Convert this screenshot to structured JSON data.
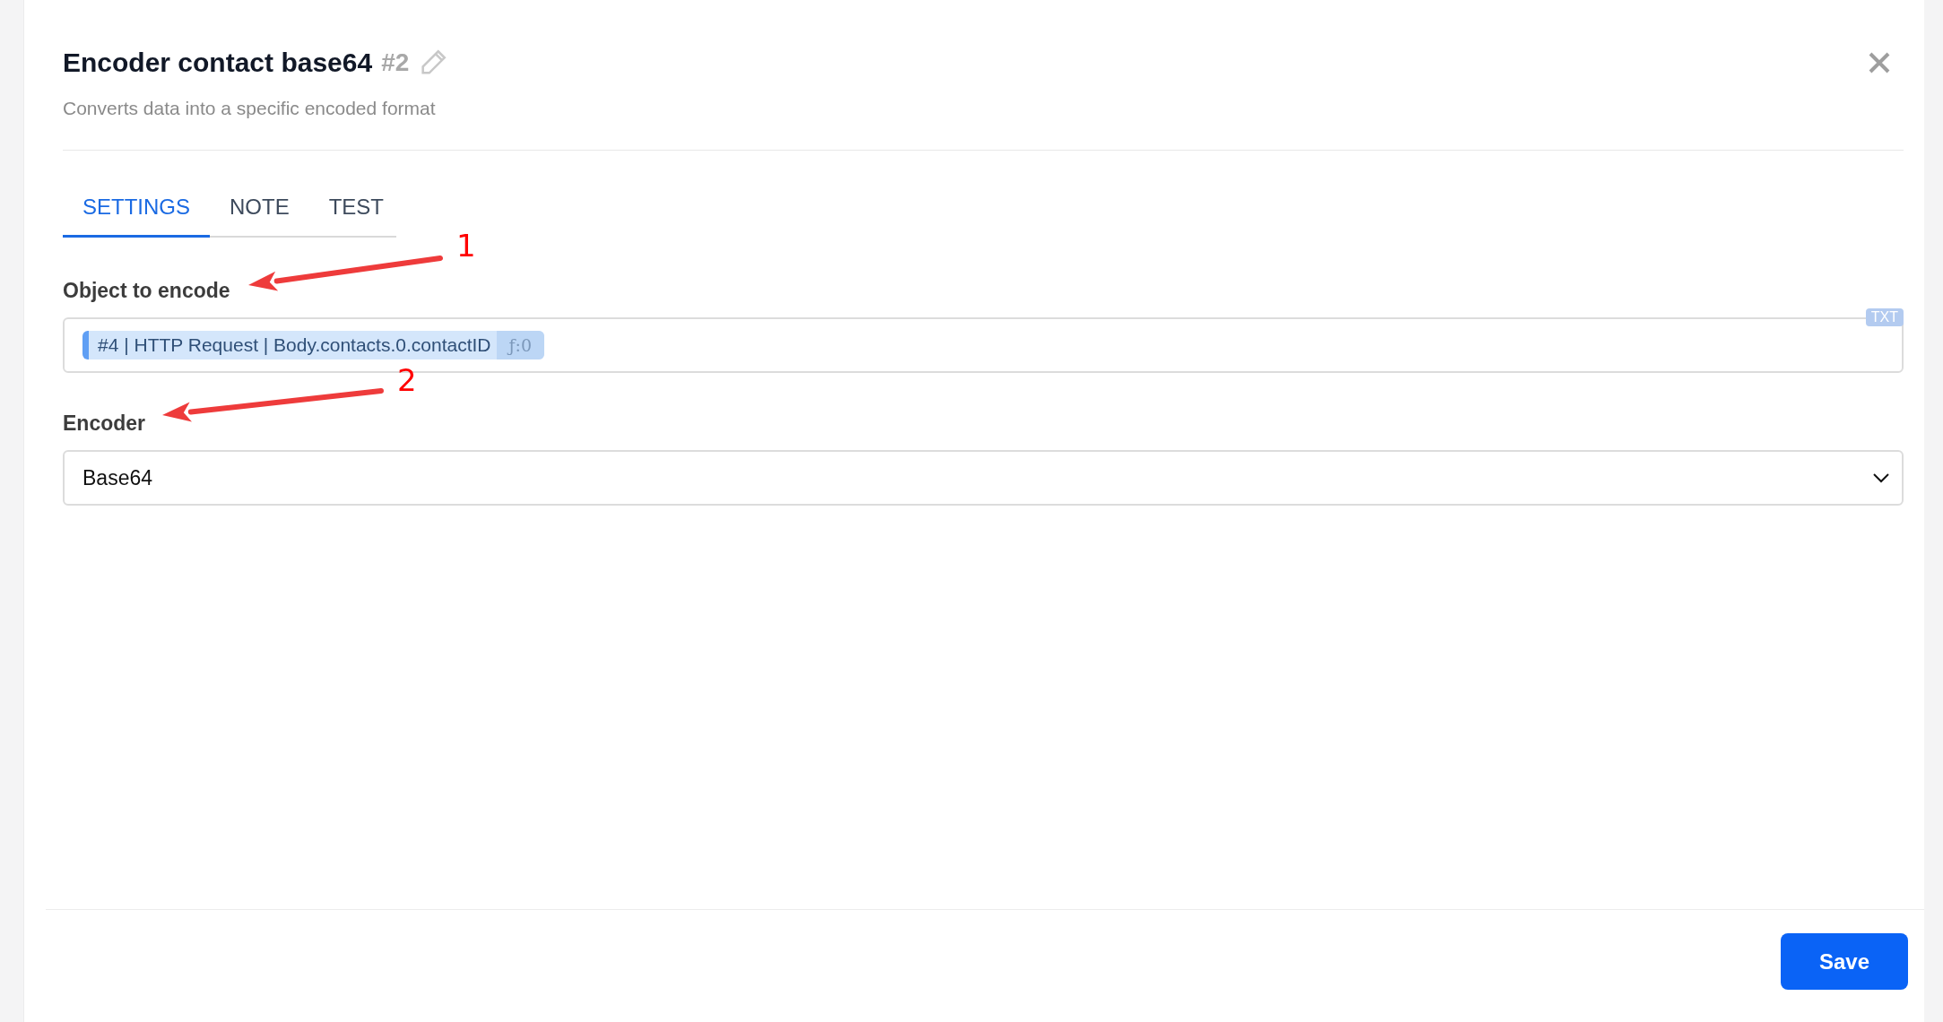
{
  "header": {
    "title": "Encoder contact base64",
    "number": "#2",
    "subtitle": "Converts data into a specific encoded format"
  },
  "tabs": [
    {
      "label": "SETTINGS",
      "selected": true
    },
    {
      "label": "NOTE",
      "selected": false
    },
    {
      "label": "TEST",
      "selected": false
    }
  ],
  "fields": [
    {
      "kind": "token",
      "label": "Object to encode",
      "badge": "TXT",
      "token": {
        "text": "#4 | HTTP Request | Body.contacts.0.contactID",
        "suffix": "ƒ:0"
      }
    },
    {
      "kind": "select",
      "label": "Encoder",
      "value": "Base64"
    }
  ],
  "annotations": [
    {
      "label": "1"
    },
    {
      "label": "2"
    }
  ],
  "footer": {
    "save": "Save"
  }
}
